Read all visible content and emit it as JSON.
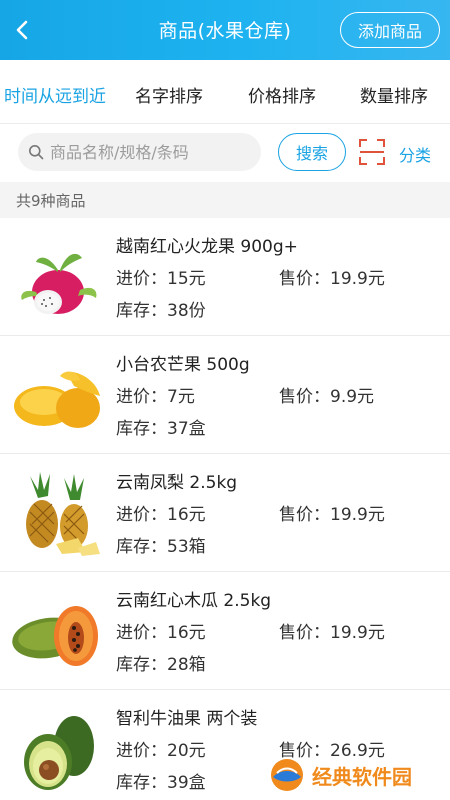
{
  "header": {
    "title": "商品(水果仓库)",
    "add_label": "添加商品"
  },
  "sort_tabs": [
    {
      "label": "时间从远到近",
      "active": true
    },
    {
      "label": "名字排序",
      "active": false
    },
    {
      "label": "价格排序",
      "active": false
    },
    {
      "label": "数量排序",
      "active": false
    }
  ],
  "search": {
    "placeholder": "商品名称/规格/条码",
    "value": "",
    "button_label": "搜索",
    "category_label": "分类"
  },
  "summary": "共9种商品",
  "products": [
    {
      "name": "越南红心火龙果  900g+",
      "buy": "进价：15元",
      "sell": "售价：19.9元",
      "stock": "库存：38份",
      "icon": "dragon-fruit"
    },
    {
      "name": "小台农芒果  500g",
      "buy": "进价：7元",
      "sell": "售价：9.9元",
      "stock": "库存：37盒",
      "icon": "mango"
    },
    {
      "name": "云南凤梨  2.5kg",
      "buy": "进价：16元",
      "sell": "售价：19.9元",
      "stock": "库存：53箱",
      "icon": "pineapple"
    },
    {
      "name": "云南红心木瓜  2.5kg",
      "buy": "进价：16元",
      "sell": "售价：19.9元",
      "stock": "库存：28箱",
      "icon": "papaya"
    },
    {
      "name": "智利牛油果  两个装",
      "buy": "进价：20元",
      "sell": "售价：26.9元",
      "stock": "库存：39盒",
      "icon": "avocado"
    }
  ],
  "watermark": "经典软件园",
  "colors": {
    "accent": "#1aa3e3",
    "header": "#1eb3f0",
    "watermark": "#f08a1c"
  }
}
